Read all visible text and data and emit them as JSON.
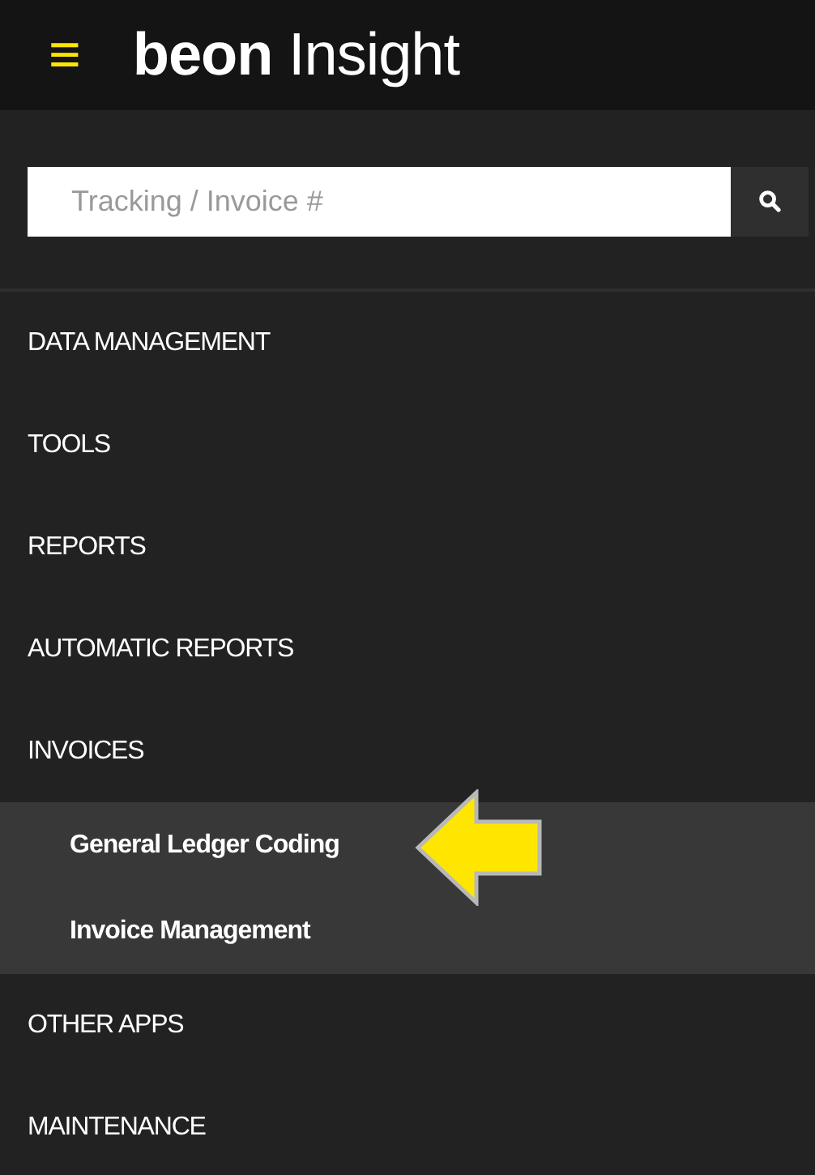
{
  "header": {
    "menu_icon": "≡",
    "logo": "**beon** Insight"
  },
  "search": {
    "placeholder": "Tracking / Invoice #"
  },
  "menu": [
    {
      "label": "DATA MANAGEMENT"
    },
    {
      "label": "TOOLS"
    },
    {
      "label": "REPORTS"
    },
    {
      "label": "AUTOMATIC REPORTS"
    },
    {
      "label": "INVOICES",
      "children": [
        {
          "label": "General Ledger Coding",
          "pointed": true
        },
        {
          "label": "Invoice Management",
          "pointed": false
        }
      ]
    },
    {
      "label": "OTHER APPS"
    },
    {
      "label": "MAINTENANCE"
    }
  ]
}
